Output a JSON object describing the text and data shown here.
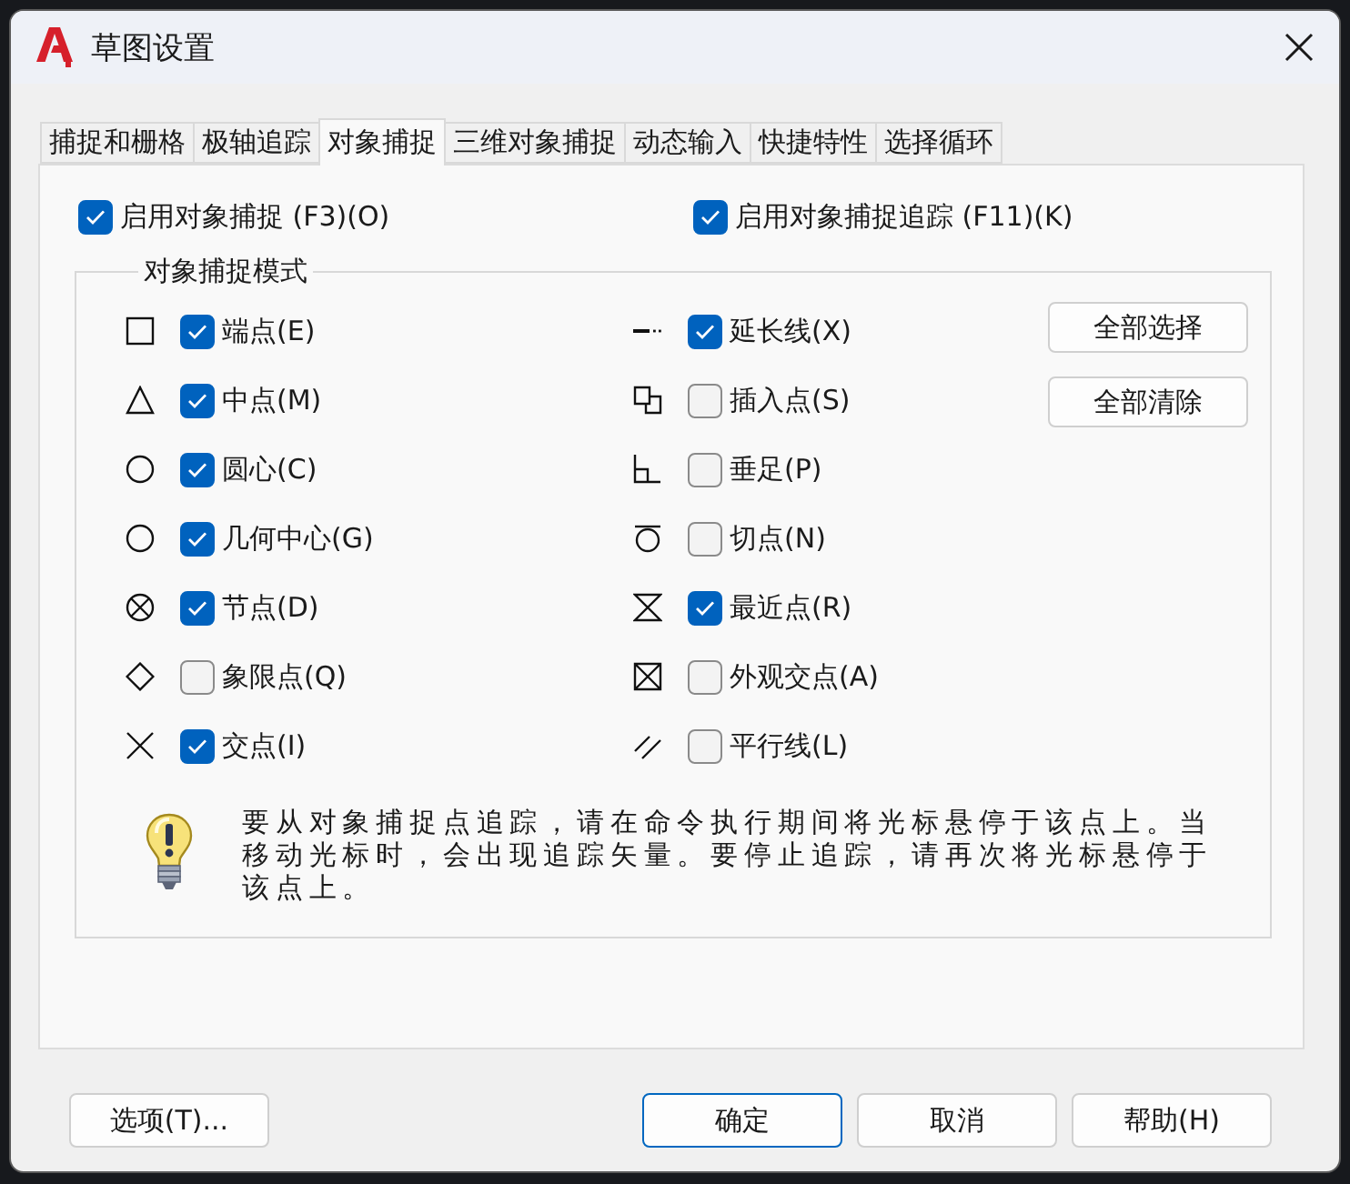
{
  "window": {
    "title": "草图设置"
  },
  "tabs": [
    {
      "label": "捕捉和栅格",
      "selected": false
    },
    {
      "label": "极轴追踪",
      "selected": false
    },
    {
      "label": "对象捕捉",
      "selected": true
    },
    {
      "label": "三维对象捕捉",
      "selected": false
    },
    {
      "label": "动态输入",
      "selected": false
    },
    {
      "label": "快捷特性",
      "selected": false
    },
    {
      "label": "选择循环",
      "selected": false
    }
  ],
  "toggles": [
    {
      "label": "启用对象捕捉 (F3)(O)",
      "checked": true
    },
    {
      "label": "启用对象捕捉追踪 (F11)(K)",
      "checked": true
    }
  ],
  "snap_modes": {
    "title": "对象捕捉模式",
    "columns": [
      {
        "items": [
          {
            "kind": "endpoint",
            "label": "端点(E)",
            "checked": true
          },
          {
            "kind": "midpoint",
            "label": "中点(M)",
            "checked": true
          },
          {
            "kind": "center",
            "label": "圆心(C)",
            "checked": true
          },
          {
            "kind": "geometric-center",
            "label": "几何中心(G)",
            "checked": true
          },
          {
            "kind": "node",
            "label": "节点(D)",
            "checked": true
          },
          {
            "kind": "quadrant",
            "label": "象限点(Q)",
            "checked": false
          },
          {
            "kind": "intersection",
            "label": "交点(I)",
            "checked": true
          }
        ]
      },
      {
        "items": [
          {
            "kind": "extension",
            "label": "延长线(X)",
            "checked": true
          },
          {
            "kind": "insertion",
            "label": "插入点(S)",
            "checked": false
          },
          {
            "kind": "perpendicular",
            "label": "垂足(P)",
            "checked": false
          },
          {
            "kind": "tangent",
            "label": "切点(N)",
            "checked": false
          },
          {
            "kind": "nearest",
            "label": "最近点(R)",
            "checked": true
          },
          {
            "kind": "apparent-intersection",
            "label": "外观交点(A)",
            "checked": false
          },
          {
            "kind": "parallel",
            "label": "平行线(L)",
            "checked": false
          }
        ]
      }
    ],
    "buttons": [
      "全部选择",
      "全部清除"
    ],
    "hint": "要从对象捕捉点追踪，请在命令执行期间将光标悬停于该点上。当移动光标时，会出现追踪矢量。要停止追踪，请再次将光标悬停于该点上。"
  },
  "buttons": [
    {
      "label": "选项(T)...",
      "default": false
    },
    {
      "label": "确定",
      "default": true
    },
    {
      "label": "取消",
      "default": false
    },
    {
      "label": "帮助(H)",
      "default": false
    }
  ]
}
